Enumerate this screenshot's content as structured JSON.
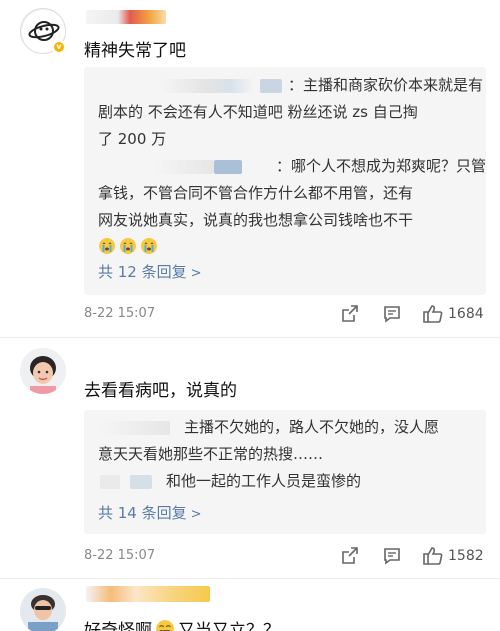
{
  "comments": [
    {
      "text": "精神失常了吧",
      "replies": [
        {
          "text_lines": [
            "：主播和商家砍价本来就是有",
            "剧本的 不会还有人不知道吧 粉丝还说 zs 自己掏",
            "了 200 万"
          ]
        },
        {
          "text_lines": [
            "：哪个人不想成为郑爽呢？只管",
            "拿钱，不管合同不管合作方什么都不用管，还有",
            "网友说她真实，说真的我也想拿公司钱啥也不干"
          ]
        }
      ],
      "more_replies": "共 12 条回复",
      "time": "8-22 15:07",
      "likes": "1684"
    },
    {
      "text": "去看看病吧，说真的",
      "replies": [
        {
          "text_lines": [
            "主播不欠她的，路人不欠她的，没人愿",
            "意天天看她那些不正常的热搜……"
          ]
        },
        {
          "text_lines": [
            "和他一起的工作人员是蛮惨的"
          ]
        }
      ],
      "more_replies": "共 14 条回复",
      "time": "8-22 15:07",
      "likes": "1582"
    },
    {
      "text": "好奇怪啊",
      "text_tail": "又当又立？？"
    }
  ],
  "icons": {
    "share": "share-icon",
    "comment": "comment-icon",
    "like": "thumbs-up-icon",
    "crying": "crying-emoji-icon",
    "laugh": "laughing-emoji-icon"
  },
  "colors": {
    "link": "#5a7ba8",
    "reply_bg": "#f5f5f5",
    "badge": "#f5b400"
  }
}
